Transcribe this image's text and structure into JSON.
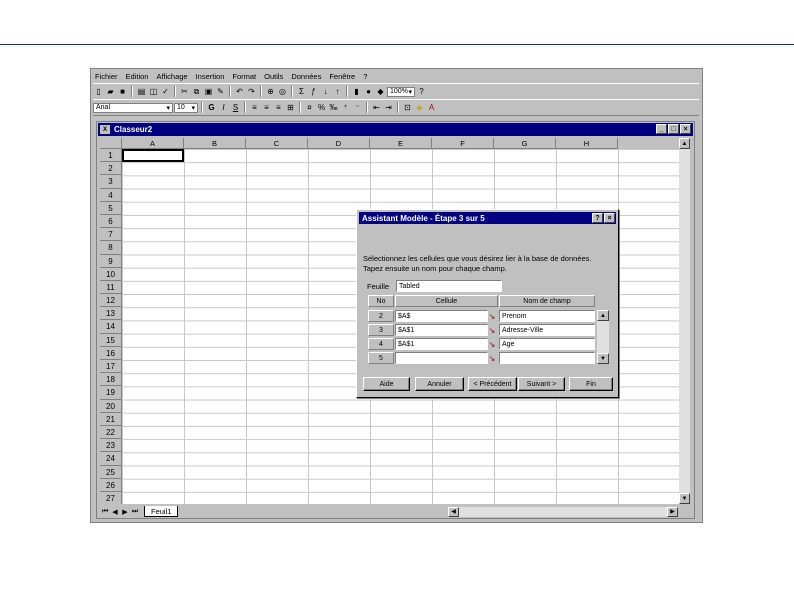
{
  "menu": [
    "Fichier",
    "Edition",
    "Affichage",
    "Insertion",
    "Format",
    "Outils",
    "Données",
    "Fenêtre",
    "?"
  ],
  "toolbar": {
    "zoom": "100%",
    "font": "Arial",
    "font_size": "10"
  },
  "workbook": {
    "title": "Classeur2",
    "columns": [
      "A",
      "B",
      "C",
      "D",
      "E",
      "F",
      "G",
      "H"
    ],
    "rows": [
      "1",
      "2",
      "3",
      "4",
      "5",
      "6",
      "7",
      "8",
      "9",
      "10",
      "11",
      "12",
      "13",
      "14",
      "15",
      "16",
      "17",
      "18",
      "19",
      "20",
      "21",
      "22",
      "23",
      "24",
      "25",
      "26",
      "27"
    ],
    "sheet_tab": "Feuil1"
  },
  "dialog": {
    "title": "Assistant Modèle - Étape 3 sur 5",
    "instruction_line1": "Sélectionnez les cellules que vous désirez lier à la base de données.",
    "instruction_line2": "Tapez ensuite un nom pour chaque champ.",
    "sheet_label": "Feuille",
    "sheet_value": "Tabled",
    "col_no": "No",
    "col_cell": "Cellule",
    "col_field": "Nom de champ",
    "rows": [
      {
        "no": "2",
        "cell": "$A$",
        "field": "Prenom"
      },
      {
        "no": "3",
        "cell": "$A$1",
        "field": "Adresse-Ville"
      },
      {
        "no": "4",
        "cell": "$A$1",
        "field": "Age"
      },
      {
        "no": "5",
        "cell": "",
        "field": ""
      }
    ],
    "buttons": {
      "help": "Aide",
      "cancel": "Annuler",
      "back": "< Précédent",
      "next": "Suivant >",
      "finish": "Fin"
    }
  }
}
